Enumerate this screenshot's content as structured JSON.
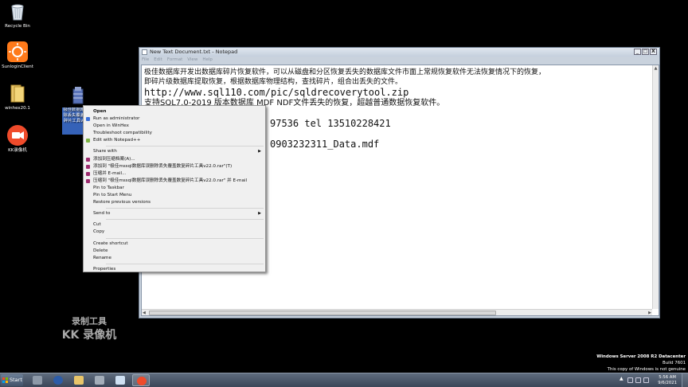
{
  "desktop": {
    "icons": [
      {
        "label": "Recycle Bin",
        "icon": "recycle-bin-icon"
      },
      {
        "label": "SunloginClient",
        "icon": "sunlogin-icon"
      },
      {
        "label": "winhex20.1",
        "icon": "folder-icon"
      },
      {
        "label": "KK录像机",
        "icon": "kk-recorder-icon"
      },
      {
        "label": "极佳数据库误删除丢失覆盖数复碎片工具v22.0",
        "icon": "archive-icon"
      }
    ]
  },
  "notepad": {
    "title": "New Text Document.txt - Notepad",
    "menu": [
      "File",
      "Edit",
      "Format",
      "View",
      "Help"
    ],
    "window_buttons": {
      "minimize": "_",
      "maximize": "□",
      "close": "X"
    },
    "lines": [
      "极佳数据库开发出数据库碎片恢复软件，可以从磁盘和分区恢复丢失的数据库文件市面上常规恢复软件无法恢复情况下的恢复，",
      "即碎片级数据库提取恢复，根据数据库物理结构，查找碎片，组合出丢失的文件。",
      "http://www.sql110.com/pic/sqldrecoverytool.zip",
      "支持SQL7.0-2019 版本数据库 MDF NDF文件丢失的恢复，超越普通数据恢复软件。",
      "",
      "97536  tel 13510228421",
      "",
      "0903232311_Data.mdf"
    ]
  },
  "context_menu": {
    "items": [
      {
        "label": "Open",
        "bold": true,
        "icon": ""
      },
      {
        "label": "Run as administrator",
        "icon": "shield-icon"
      },
      {
        "label": "Open in WinHex",
        "icon": ""
      },
      {
        "label": "Troubleshoot compatibility",
        "icon": ""
      },
      {
        "label": "Edit with Notepad++",
        "icon": "notepadpp-icon"
      },
      {
        "sep": true
      },
      {
        "label": "Share with",
        "submenu": true
      },
      {
        "label": "添加到压缩档案(A)...",
        "icon": "winrar-icon"
      },
      {
        "label": "添加到 \"极佳mssql数据库误删除丢失覆盖数复碎片工具v22.0.rar\"(T)",
        "icon": "winrar-icon"
      },
      {
        "label": "压缩并 E-mail...",
        "icon": "winrar-icon"
      },
      {
        "label": "压缩到 \"极佳mssql数据库误删除丢失覆盖数复碎片工具v22.0.rar\" 并 E-mail",
        "icon": "winrar-icon"
      },
      {
        "label": "Pin to Taskbar"
      },
      {
        "label": "Pin to Start Menu"
      },
      {
        "label": "Restore previous versions"
      },
      {
        "sep": true
      },
      {
        "label": "Send to",
        "submenu": true
      },
      {
        "sep": true
      },
      {
        "label": "Cut"
      },
      {
        "label": "Copy"
      },
      {
        "sep": true
      },
      {
        "label": "Create shortcut"
      },
      {
        "label": "Delete"
      },
      {
        "label": "Rename"
      },
      {
        "sep": true
      },
      {
        "label": "Properties"
      }
    ]
  },
  "watermark": {
    "line1": "录制工具",
    "line2": "KK 录像机"
  },
  "windows_version": {
    "line1": "Windows Server 2008 R2 Datacenter",
    "line2": "Build 7601",
    "line3": "This copy of Windows is not genuine"
  },
  "taskbar": {
    "start_label": "Start",
    "clock": {
      "time": "5:56 AM",
      "date": "9/6/2021"
    },
    "buttons": [
      "server-manager-icon",
      "powershell-icon",
      "explorer-icon",
      "tools-icon",
      "notepad-icon",
      "kk-recorder-icon"
    ]
  },
  "colors": {
    "accent": "#3b4658",
    "desktop": "#000000",
    "title_bar": "#c5d0dd"
  }
}
